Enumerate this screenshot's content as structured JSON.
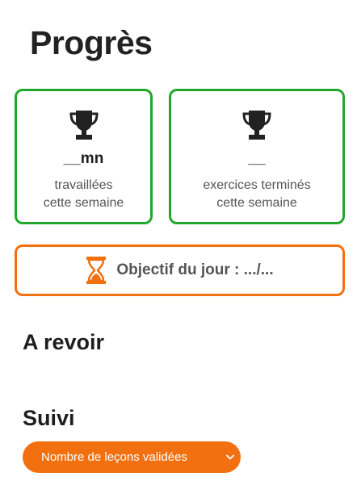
{
  "page": {
    "title": "Progrès"
  },
  "stats": [
    {
      "icon": "trophy-icon",
      "value": "__mn",
      "label_line1": "travaillées",
      "label_line2": "cette semaine"
    },
    {
      "icon": "trophy-icon",
      "value": "__",
      "label_line1": "exercices terminés",
      "label_line2": "cette semaine"
    }
  ],
  "goal": {
    "icon": "hourglass-icon",
    "text": "Objectif du jour : .../..."
  },
  "sections": {
    "review_title": "A revoir",
    "tracking_title": "Suivi"
  },
  "tracking_select": {
    "selected": "Nombre de leçons validées"
  },
  "colors": {
    "green": "#1fa82a",
    "orange": "#f27010",
    "text_dark": "#222222",
    "text_muted": "#555555"
  }
}
